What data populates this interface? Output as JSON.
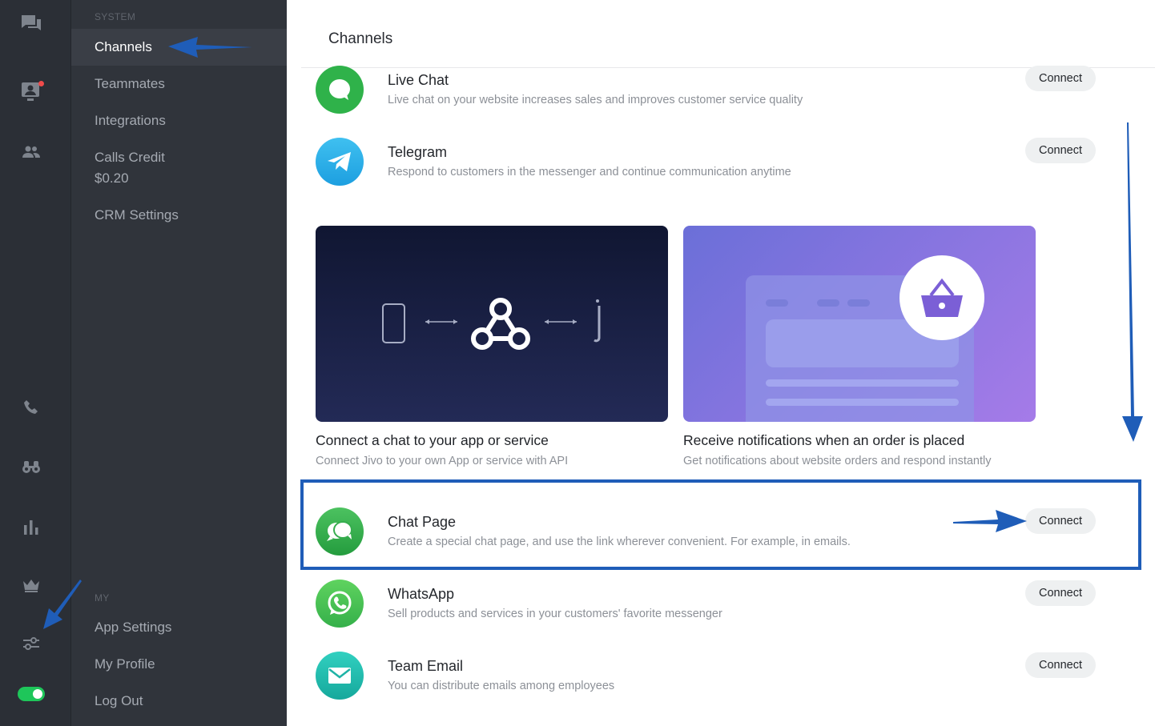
{
  "colors": {
    "rail_bg": "#2b2f36",
    "menu_bg": "#30343b",
    "menu_active_bg": "#3a3e46",
    "toggle_on": "#1ec65a",
    "annotation_blue": "#1f5db8"
  },
  "rail": {
    "icons": [
      "chats-icon",
      "visitors-icon",
      "team-icon",
      "phone-icon",
      "binoculars-icon",
      "stats-icon",
      "crown-icon",
      "settings-sliders-icon",
      "status-toggle"
    ]
  },
  "menu": {
    "system_label": "SYSTEM",
    "items": [
      {
        "label": "Channels"
      },
      {
        "label": "Teammates"
      },
      {
        "label": "Integrations"
      },
      {
        "label": "Calls Credit",
        "sub": "$0.20"
      },
      {
        "label": "CRM Settings"
      }
    ],
    "my_label": "MY",
    "my_items": [
      {
        "label": "App Settings"
      },
      {
        "label": "My Profile"
      },
      {
        "label": "Log Out"
      }
    ]
  },
  "main": {
    "title": "Channels",
    "channels": [
      {
        "name": "Live Chat",
        "desc": "Live chat on your website increases sales and improves customer service quality",
        "button": "Connect",
        "icon": "live-chat-icon"
      },
      {
        "name": "Telegram",
        "desc": "Respond to customers in the messenger and continue communication anytime",
        "button": "Connect",
        "icon": "telegram-icon"
      }
    ],
    "cards": [
      {
        "title": "Connect a chat to your app or service",
        "desc": "Connect Jivo to your own App or service with API"
      },
      {
        "title": "Receive notifications when an order is placed",
        "desc": "Get notifications about website orders and respond instantly"
      }
    ],
    "channels_bottom": [
      {
        "name": "Chat Page",
        "desc": "Create a special chat page, and use the link wherever convenient. For example, in emails.",
        "button": "Connect",
        "icon": "chat-page-icon"
      },
      {
        "name": "WhatsApp",
        "desc": "Sell products and services in your customers' favorite messenger",
        "button": "Connect",
        "icon": "whatsapp-icon"
      },
      {
        "name": "Team Email",
        "desc": "You can distribute emails among employees",
        "button": "Connect",
        "icon": "email-icon"
      }
    ]
  }
}
